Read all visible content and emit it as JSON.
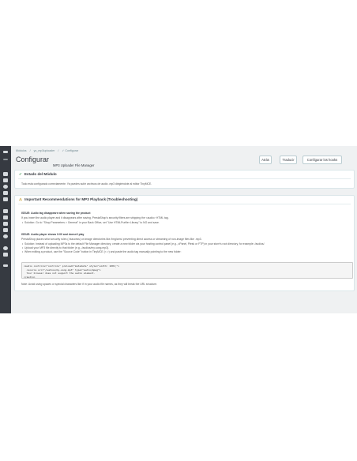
{
  "sidebar": {
    "icons": [
      "menu-icon",
      "dashboard-icon",
      "orders-icon",
      "catalog-icon",
      "customers-icon",
      "messages-icon",
      "stats-icon",
      "modules-icon",
      "design-icon",
      "shipping-icon",
      "payment-icon",
      "international-icon",
      "settings-icon",
      "advanced-icon",
      "extra-icon"
    ]
  },
  "breadcrumb": {
    "items": [
      "Módulos",
      "yu_mp3uploader",
      "✓ Configurar"
    ]
  },
  "header": {
    "title": "Configurar",
    "subtitle": "MP3 Uploader File Manager",
    "buttons": [
      "Atrás",
      "Traducir",
      "Configurar los hooks"
    ]
  },
  "status_panel": {
    "icon": "check-icon",
    "title": "Estado del Módulo",
    "text": "Todo está configurado correctamente. Ya puedes subir archivos de audio .mp3 dirigiéndote al editor TinyMCE."
  },
  "warning_panel": {
    "icon": "warning-icon",
    "title": "Important Recommendations for MP3 Playback (Troubleshooting)",
    "issue1_title": "ISSUE: Audio tag disappears when saving the product",
    "issue1_text": "If you insert the audio player and it disappears after saving, PrestaShop's security filters are stripping the <audio> HTML tag.",
    "issue1_solution": "Solution: Go to \"Shop Parameters > General\" in your Back Office, set \"Use HTMLPurifier Library\" to NO and save.",
    "issue2_title": "ISSUE: Audio player shows 0:00 and doesn't play",
    "issue2_text": "PrestaShop places strict security rules (.htaccess) on image directories like /img/cms/ preventing direct access or streaming of non-image files like .mp3.",
    "issue2_bullets": [
      "Solution: Instead of uploading MP3s to the default File Manager directory, create a new folder via your hosting control panel (e.g., cPanel, Plesk or FTP) in your store's root directory, for example: /audios/.",
      "Upload your MP3 file directly to that folder (e.g., /audios/my-song.mp3).",
      "When editing a product, use the \"Source Code\" button in TinyMCE (< >) and paste the audio tag manually pointing to the new folder:"
    ],
    "code_lines": [
      "<audio controls=\"controls\" preload=\"metadata\" style=\"width: 100%;\">",
      "  <source src=\"/audios/my-song.mp3\" type=\"audio/mpeg\">",
      "  Your browser does not support the audio element.",
      "</audio>"
    ],
    "note": "Note: Avoid using spaces or special characters like ñ in your audio file names, as they will break the URL structure."
  }
}
